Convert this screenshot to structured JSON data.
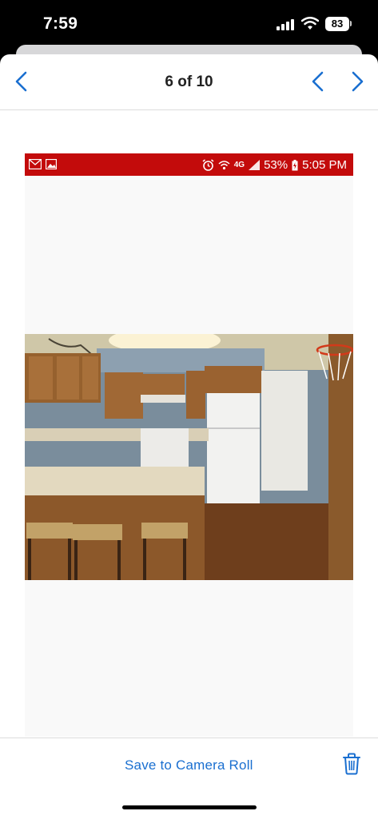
{
  "status_bar": {
    "time": "7:59",
    "battery": "83"
  },
  "nav": {
    "title": "6 of 10"
  },
  "screenshot": {
    "status": {
      "battery": "53%",
      "time": "5:05 PM",
      "network": "4G"
    }
  },
  "footer": {
    "save_label": "Save to Camera Roll"
  },
  "icons": {
    "back": "chevron-left-icon",
    "prev": "chevron-left-icon",
    "next": "chevron-right-icon",
    "trash": "trash-icon"
  },
  "colors": {
    "accent": "#1a6fd0",
    "phone_status_bg": "#c30b0b"
  }
}
